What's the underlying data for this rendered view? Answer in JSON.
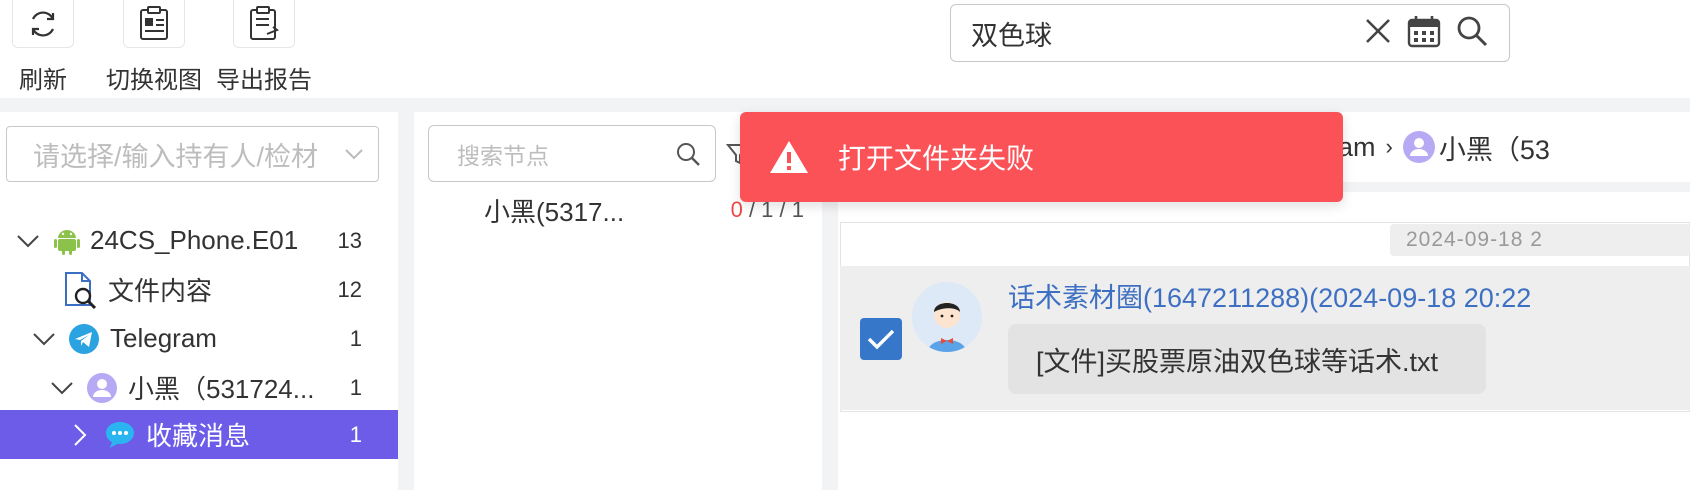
{
  "toolbar": {
    "refresh_label": "刷新",
    "switch_view_label": "切换视图",
    "export_label": "导出报告",
    "search_value": "双色球"
  },
  "left": {
    "owner_placeholder": "请选择/输入持有人/检材",
    "tree": [
      {
        "label": "24CS_Phone.E01",
        "count": "13"
      },
      {
        "label": "文件内容",
        "count": "12"
      },
      {
        "label": "Telegram",
        "count": "1"
      },
      {
        "label": "小黑（531724...",
        "count": "1"
      },
      {
        "label": "收藏消息",
        "count": "1"
      }
    ]
  },
  "middle": {
    "search_placeholder": "搜索节点",
    "node_name": "小黑(5317...",
    "stat_red": "0",
    "stat_rest": " / 1 / 1"
  },
  "right": {
    "breadcrumb_telegram": "am",
    "breadcrumb_user": "小黑（53",
    "date_chip": "2024-09-18 2",
    "sender": "话术素材圈(1647211288)(2024-09-18 20:22",
    "message": "[文件]买股票原油双色球等话术.txt"
  },
  "toast": {
    "message": "打开文件夹失败"
  },
  "colors": {
    "accent": "#6d5ce8",
    "toast_bg": "#fb5257",
    "link": "#3d6fc2",
    "checkbox": "#3677c9"
  }
}
